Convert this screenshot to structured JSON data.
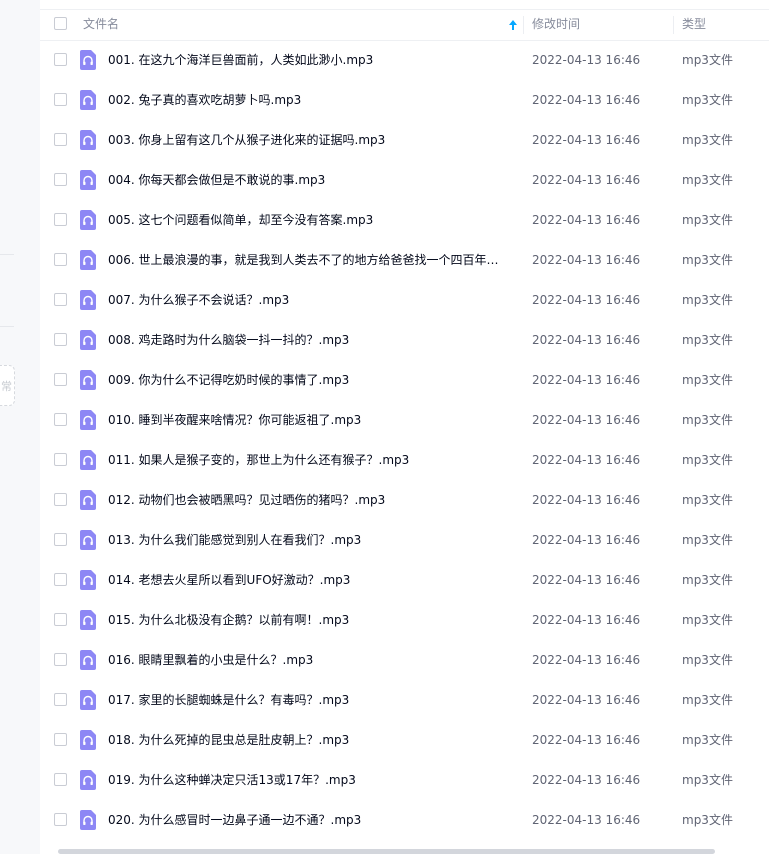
{
  "header": {
    "name": "文件名",
    "time": "修改时间",
    "type": "类型"
  },
  "sidebar": {
    "stub_text": "常"
  },
  "files": [
    {
      "name": "001. 在这九个海洋巨兽面前，人类如此渺小.mp3",
      "time": "2022-04-13 16:46",
      "type": "mp3文件"
    },
    {
      "name": "002. 兔子真的喜欢吃胡萝卜吗.mp3",
      "time": "2022-04-13 16:46",
      "type": "mp3文件"
    },
    {
      "name": "003. 你身上留有这几个从猴子进化来的证据吗.mp3",
      "time": "2022-04-13 16:46",
      "type": "mp3文件"
    },
    {
      "name": "004. 你每天都会做但是不敢说的事.mp3",
      "time": "2022-04-13 16:46",
      "type": "mp3文件"
    },
    {
      "name": "005. 这七个问题看似简单，却至今没有答案.mp3",
      "time": "2022-04-13 16:46",
      "type": "mp3文件"
    },
    {
      "name": "006. 世上最浪漫的事，就是我到人类去不了的地方给爸爸找一个四百年的...",
      "time": "2022-04-13 16:46",
      "type": "mp3文件"
    },
    {
      "name": "007. 为什么猴子不会说话？.mp3",
      "time": "2022-04-13 16:46",
      "type": "mp3文件"
    },
    {
      "name": "008. 鸡走路时为什么脑袋一抖一抖的？.mp3",
      "time": "2022-04-13 16:46",
      "type": "mp3文件"
    },
    {
      "name": "009. 你为什么不记得吃奶时候的事情了.mp3",
      "time": "2022-04-13 16:46",
      "type": "mp3文件"
    },
    {
      "name": "010. 睡到半夜醒来啥情况？你可能返祖了.mp3",
      "time": "2022-04-13 16:46",
      "type": "mp3文件"
    },
    {
      "name": "011. 如果人是猴子变的，那世上为什么还有猴子？.mp3",
      "time": "2022-04-13 16:46",
      "type": "mp3文件"
    },
    {
      "name": "012. 动物们也会被晒黑吗？见过晒伤的猪吗？.mp3",
      "time": "2022-04-13 16:46",
      "type": "mp3文件"
    },
    {
      "name": "013. 为什么我们能感觉到别人在看我们？.mp3",
      "time": "2022-04-13 16:46",
      "type": "mp3文件"
    },
    {
      "name": "014. 老想去火星所以看到UFO好激动？.mp3",
      "time": "2022-04-13 16:46",
      "type": "mp3文件"
    },
    {
      "name": "015. 为什么北极没有企鹅？以前有啊！.mp3",
      "time": "2022-04-13 16:46",
      "type": "mp3文件"
    },
    {
      "name": "016. 眼睛里飘着的小虫是什么？.mp3",
      "time": "2022-04-13 16:46",
      "type": "mp3文件"
    },
    {
      "name": "017. 家里的长腿蜘蛛是什么？有毒吗？.mp3",
      "time": "2022-04-13 16:46",
      "type": "mp3文件"
    },
    {
      "name": "018. 为什么死掉的昆虫总是肚皮朝上？.mp3",
      "time": "2022-04-13 16:46",
      "type": "mp3文件"
    },
    {
      "name": "019. 为什么这种蝉决定只活13或17年？.mp3",
      "time": "2022-04-13 16:46",
      "type": "mp3文件"
    },
    {
      "name": "020. 为什么感冒时一边鼻子通一边不通？.mp3",
      "time": "2022-04-13 16:46",
      "type": "mp3文件"
    }
  ],
  "colors": {
    "accent": "#06a7ff",
    "file_icon": "#8d87f5"
  },
  "icons": {
    "sort": "sort-ascending-icon",
    "file": "audio-file-icon"
  }
}
